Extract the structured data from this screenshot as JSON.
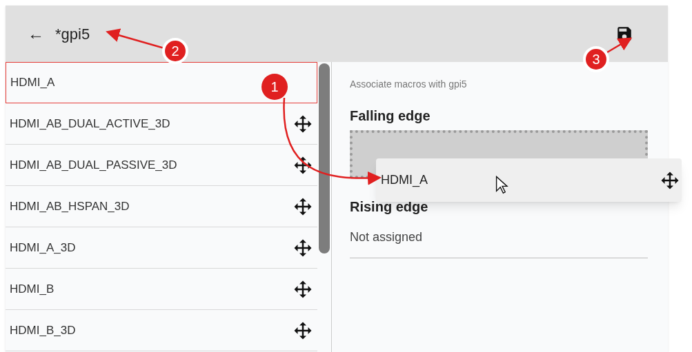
{
  "header": {
    "back_symbol": "←",
    "title": "*gpi5"
  },
  "macros": [
    {
      "label": "HDMI_A",
      "selected": true
    },
    {
      "label": "HDMI_AB_DUAL_ACTIVE_3D",
      "selected": false
    },
    {
      "label": "HDMI_AB_DUAL_PASSIVE_3D",
      "selected": false
    },
    {
      "label": "HDMI_AB_HSPAN_3D",
      "selected": false
    },
    {
      "label": "HDMI_A_3D",
      "selected": false
    },
    {
      "label": "HDMI_B",
      "selected": false
    },
    {
      "label": "HDMI_B_3D",
      "selected": false
    }
  ],
  "detail": {
    "caption": "Associate macros with gpi5",
    "sections": [
      {
        "title": "Falling edge",
        "kind": "dropzone"
      },
      {
        "title": "Rising edge",
        "kind": "empty",
        "value": "Not assigned"
      }
    ]
  },
  "drag_preview": {
    "label": "HDMI_A"
  },
  "annotations": [
    {
      "label": "1"
    },
    {
      "label": "2"
    },
    {
      "label": "3"
    }
  ]
}
